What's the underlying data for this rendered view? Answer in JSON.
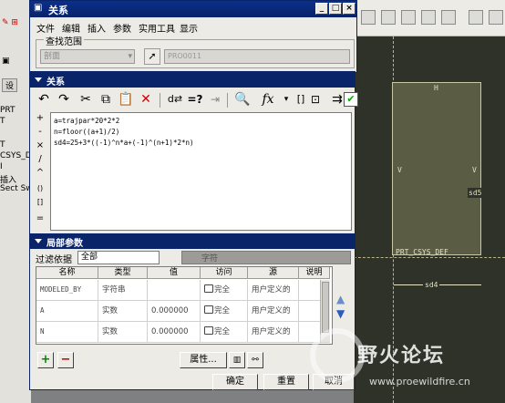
{
  "background_app": {
    "tree_items": [
      "PRT",
      "T",
      "",
      "T",
      "CSYS_DE",
      "I",
      "插入",
      "Sect Sw"
    ],
    "tree_tab_label": "设",
    "canvas_labels": {
      "top_dim": "H",
      "left_v": "V",
      "right_v": "V",
      "right_dim": "sd5",
      "csys": "PRT_CSYS_DEF",
      "bottom_dim": "sd4"
    }
  },
  "outer_dialog": {
    "title": "关系",
    "menu": [
      "文件",
      "编辑",
      "插入",
      "参数",
      "实用工具",
      "显示"
    ],
    "scope_group_label": "查找范围",
    "scope_value": "剖面",
    "scope_object": "PRO0011"
  },
  "relations_panel": {
    "header": "关系",
    "side_tools": [
      "+",
      "-",
      "×",
      "/",
      "^",
      "()",
      "[]",
      "="
    ],
    "lines": [
      "a=trajpar*20*2*2",
      "n=floor((a+1)/2)",
      "sd4=25+3*((-1)^n*a+(-1)^(n+1)*2*n)"
    ]
  },
  "local_params": {
    "header": "局部参数",
    "filter_label": "过滤依据",
    "filter_value": "全部",
    "filter_right_label": "字符",
    "columns": [
      "名称",
      "类型",
      "值",
      "访问",
      "源",
      "说明"
    ],
    "rows": [
      {
        "name": "MODELED_BY",
        "type": "字符串",
        "value": "",
        "access": "完全",
        "source": "用户定义的",
        "desc": ""
      },
      {
        "name": "A",
        "type": "实数",
        "value": "0.000000",
        "access": "完全",
        "source": "用户定义的",
        "desc": ""
      },
      {
        "name": "N",
        "type": "实数",
        "value": "0.000000",
        "access": "完全",
        "source": "用户定义的",
        "desc": ""
      }
    ],
    "add_label": "+",
    "remove_label": "−",
    "properties_label": "属性..."
  },
  "footer": {
    "ok": "确定",
    "reset": "重置",
    "cancel": "取消"
  },
  "watermark": {
    "title": "野火论坛",
    "url": "www.proewildfire.cn"
  }
}
